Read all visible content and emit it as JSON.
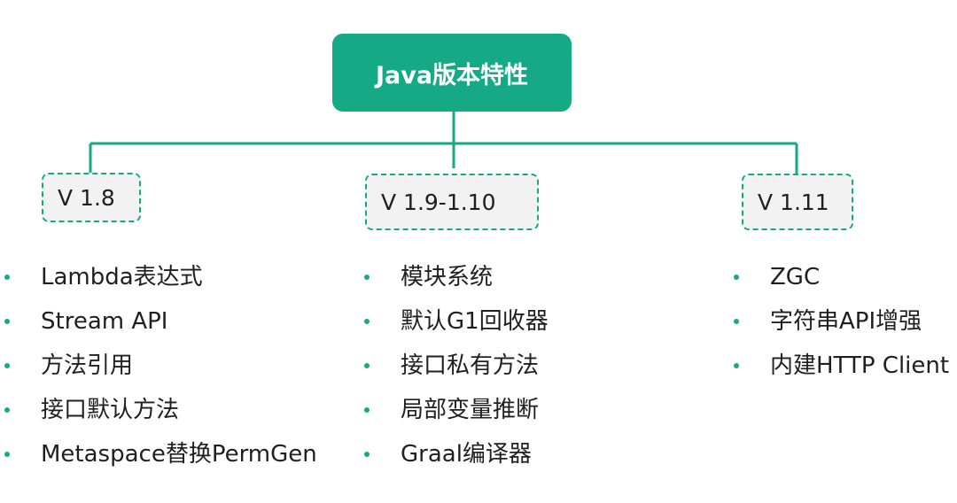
{
  "root": {
    "label": "Java版本特性"
  },
  "colors": {
    "accent": "#16a985",
    "box_fill": "#f2f2f2"
  },
  "versions": [
    {
      "label": "V 1.8",
      "features": [
        "Lambda表达式",
        "Stream API",
        "方法引用",
        "接口默认方法",
        "Metaspace替换PermGen"
      ]
    },
    {
      "label": "V 1.9-1.10",
      "features": [
        "模块系统",
        "默认G1回收器",
        "接口私有方法",
        "局部变量推断",
        "Graal编译器"
      ]
    },
    {
      "label": "V 1.11",
      "features": [
        "ZGC",
        "字符串API增强",
        "内建HTTP Client"
      ]
    }
  ]
}
